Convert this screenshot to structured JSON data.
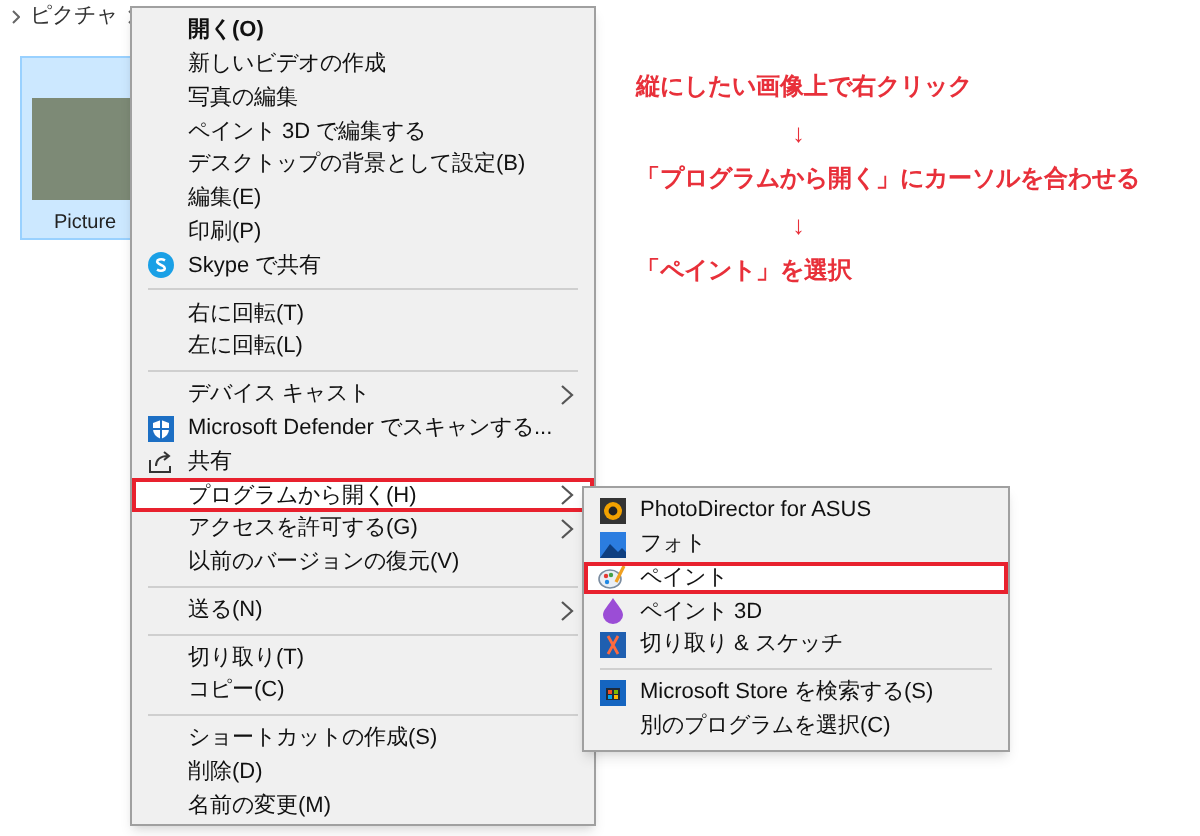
{
  "breadcrumb": [
    "ピクチャ"
  ],
  "file": {
    "name": "Picture",
    "selected": true
  },
  "annotations": [
    {
      "kind": "text",
      "text": "縦にしたい画像上で右クリック"
    },
    {
      "kind": "arrow",
      "text": "↓"
    },
    {
      "kind": "text",
      "text": "「プログラムから開く」にカーソルを合わせる"
    },
    {
      "kind": "arrow",
      "text": "↓"
    },
    {
      "kind": "text",
      "text": "「ペイント」を選択"
    }
  ],
  "context_menu": [
    {
      "kind": "item",
      "label": "開く(O)",
      "bold": true,
      "submenu": false,
      "highlighted": false
    },
    {
      "kind": "item",
      "label": "新しいビデオの作成",
      "submenu": false,
      "highlighted": false
    },
    {
      "kind": "item",
      "label": "写真の編集",
      "submenu": false,
      "highlighted": false
    },
    {
      "kind": "item",
      "label": "ペイント 3D で編集する",
      "submenu": false,
      "highlighted": false
    },
    {
      "kind": "item",
      "label": "デスクトップの背景として設定(B)",
      "submenu": false,
      "highlighted": false
    },
    {
      "kind": "item",
      "label": "編集(E)",
      "submenu": false,
      "highlighted": false
    },
    {
      "kind": "item",
      "label": "印刷(P)",
      "submenu": false,
      "highlighted": false
    },
    {
      "kind": "item",
      "label": "Skype で共有",
      "submenu": false,
      "highlighted": false
    },
    {
      "kind": "separator"
    },
    {
      "kind": "item",
      "label": "右に回転(T)",
      "submenu": false,
      "highlighted": false
    },
    {
      "kind": "item",
      "label": "左に回転(L)",
      "submenu": false,
      "highlighted": false
    },
    {
      "kind": "separator"
    },
    {
      "kind": "item",
      "label": "デバイス キャスト",
      "submenu": true,
      "highlighted": false
    },
    {
      "kind": "item",
      "label": "Microsoft Defender でスキャンする...",
      "submenu": false,
      "highlighted": false
    },
    {
      "kind": "item",
      "label": "共有",
      "submenu": false,
      "highlighted": false
    },
    {
      "kind": "item",
      "label": "プログラムから開く(H)",
      "submenu": true,
      "highlighted": true
    },
    {
      "kind": "item",
      "label": "アクセスを許可する(G)",
      "submenu": true,
      "highlighted": false
    },
    {
      "kind": "item",
      "label": "以前のバージョンの復元(V)",
      "submenu": false,
      "highlighted": false
    },
    {
      "kind": "separator"
    },
    {
      "kind": "item",
      "label": "送る(N)",
      "submenu": true,
      "highlighted": false
    },
    {
      "kind": "separator"
    },
    {
      "kind": "item",
      "label": "切り取り(T)",
      "submenu": false,
      "highlighted": false
    },
    {
      "kind": "item",
      "label": "コピー(C)",
      "submenu": false,
      "highlighted": false
    },
    {
      "kind": "separator"
    },
    {
      "kind": "item",
      "label": "ショートカットの作成(S)",
      "submenu": false,
      "highlighted": false
    },
    {
      "kind": "item",
      "label": "削除(D)",
      "submenu": false,
      "highlighted": false
    },
    {
      "kind": "item",
      "label": "名前の変更(M)",
      "submenu": false,
      "highlighted": false
    }
  ],
  "open_with_menu": [
    {
      "kind": "item",
      "label": "PhotoDirector for ASUS",
      "highlighted": false
    },
    {
      "kind": "item",
      "label": "フォト",
      "highlighted": false
    },
    {
      "kind": "item",
      "label": "ペイント",
      "highlighted": true
    },
    {
      "kind": "item",
      "label": "ペイント 3D",
      "highlighted": false
    },
    {
      "kind": "item",
      "label": "切り取り & スケッチ",
      "highlighted": false
    },
    {
      "kind": "separator"
    },
    {
      "kind": "item",
      "label": "Microsoft Store を検索する(S)",
      "highlighted": false
    },
    {
      "kind": "item",
      "label": "別のプログラムを選択(C)",
      "highlighted": false
    }
  ]
}
